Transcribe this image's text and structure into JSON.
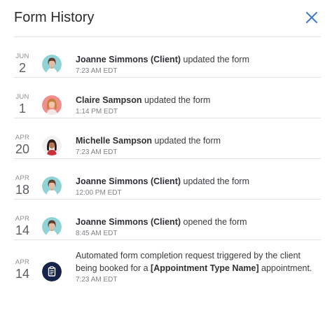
{
  "header": {
    "title": "Form History",
    "close_icon": "close-icon",
    "accent": "#3f7ad1"
  },
  "history": [
    {
      "month": "JUN",
      "day": "2",
      "avatar": "avatar-joanne",
      "actor": "Joanne Simmons (Client)",
      "action": " updated the form",
      "time": "7:23 AM EDT"
    },
    {
      "month": "JUN",
      "day": "1",
      "avatar": "avatar-claire",
      "actor": "Claire Sampson",
      "action": " updated the form",
      "time": "1:14 PM EDT"
    },
    {
      "month": "APR",
      "day": "20",
      "avatar": "avatar-michelle",
      "actor": "Michelle Sampson",
      "action": " updated the form",
      "time": "7:23 AM EDT"
    },
    {
      "month": "APR",
      "day": "18",
      "avatar": "avatar-joanne",
      "actor": "Joanne Simmons (Client)",
      "action": " updated the form",
      "time": "12:00 PM EDT"
    },
    {
      "month": "APR",
      "day": "14",
      "avatar": "avatar-joanne",
      "actor": "Joanne Simmons (Client)",
      "action": " opened the form",
      "time": "8:45 AM EDT"
    },
    {
      "month": "APR",
      "day": "14",
      "icon": "clipboard-icon",
      "text_before": "Automated form completion request triggered by the client being booked for a ",
      "bold": "[Appointment Type Name]",
      "text_after": " appointment.",
      "time": "7:23 AM EDT"
    }
  ]
}
